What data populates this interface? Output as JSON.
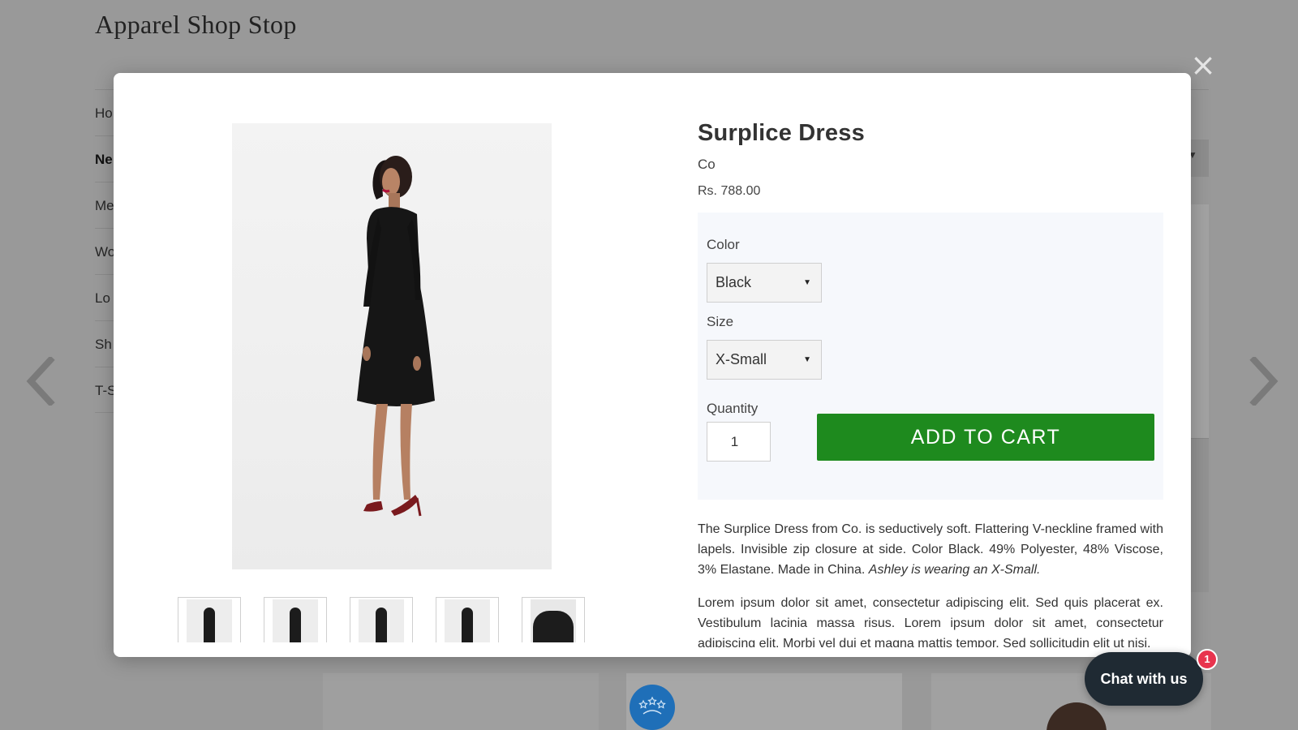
{
  "store": {
    "title": "Apparel Shop Stop"
  },
  "background_nav": {
    "items": [
      {
        "label": "Ho"
      },
      {
        "label": "Ne"
      },
      {
        "label": "Me"
      },
      {
        "label": "Wo"
      },
      {
        "label": "Lo"
      },
      {
        "label": "Sh"
      },
      {
        "label": "T-S"
      }
    ]
  },
  "modal": {
    "close_icon": "×",
    "product": {
      "title": "Surplice Dress",
      "brand": "Co",
      "price": "Rs. 788.00",
      "thumbnails_count": 5
    },
    "options": {
      "color_label": "Color",
      "color_value": "Black",
      "size_label": "Size",
      "size_value": "X-Small",
      "quantity_label": "Quantity",
      "quantity_value": "1"
    },
    "add_to_cart_label": "ADD TO CART",
    "description": {
      "para1_text": "The Surplice Dress from Co. is seductively soft. Flattering V-neckline framed with lapels. Invisible zip closure at side. Color Black. 49% Polyester, 48% Viscose, 3% Elastane. Made in China. ",
      "para1_em": "Ashley is wearing an X-Small.",
      "para2": "Lorem ipsum dolor sit amet, consectetur adipiscing elit. Sed quis placerat ex. Vestibulum lacinia massa risus. Lorem ipsum dolor sit amet, consectetur adipiscing elit. Morbi vel dui et magna mattis tempor. Sed sollicitudin elit ut nisi."
    }
  },
  "chat": {
    "label": "Chat with us",
    "badge_count": "1"
  },
  "icons": {
    "prev_arrow": "chevron-left-icon",
    "next_arrow": "chevron-right-icon",
    "close": "close-icon",
    "dropdown": "caret-down-icon"
  },
  "colors": {
    "overlay_bg": "#999999",
    "add_to_cart_bg": "#1e8a1e",
    "options_bg": "#f6f8fc",
    "chat_bg": "#1f2a33",
    "chat_badge": "#e8344e"
  }
}
